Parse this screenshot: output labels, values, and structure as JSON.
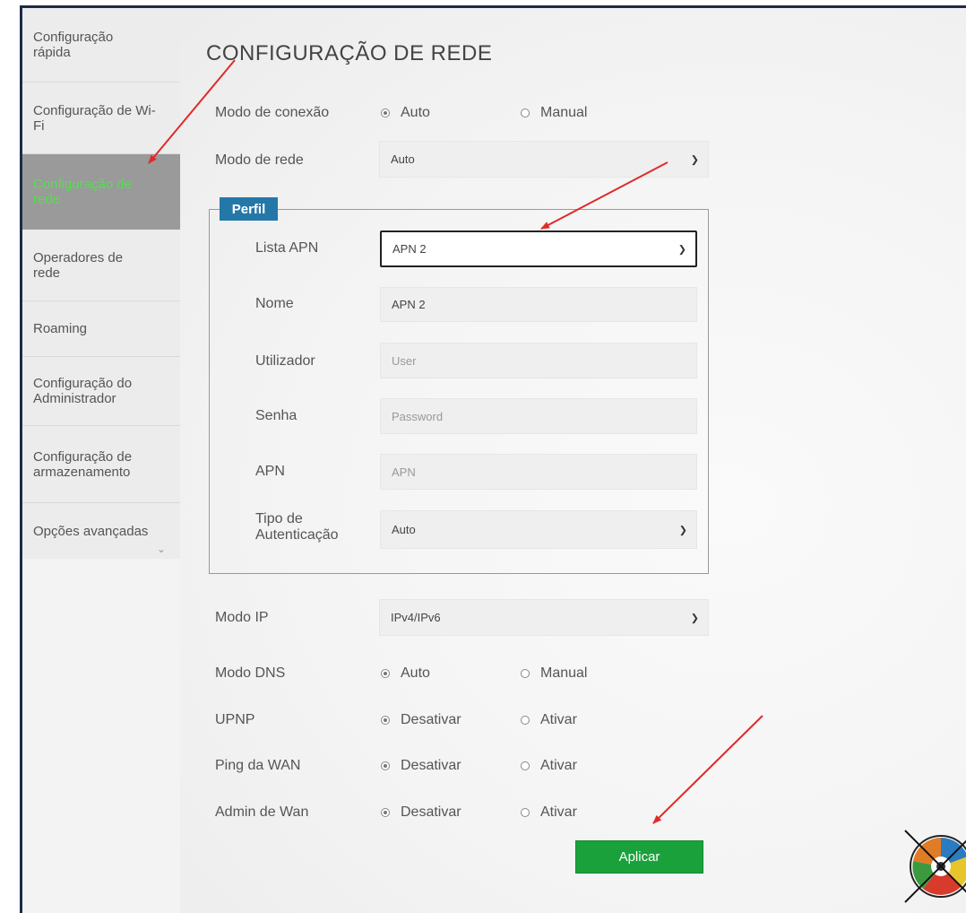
{
  "sidebar": {
    "items": [
      {
        "label": "Configuração rápida"
      },
      {
        "label": "Configuração de Wi-Fi"
      },
      {
        "label": "Configuração de rede"
      },
      {
        "label": "Operadores de rede"
      },
      {
        "label": "Roaming"
      },
      {
        "label": "Configuração do Administrador"
      },
      {
        "label": "Configuração de armazenamento"
      },
      {
        "label": "Opções avançadas"
      }
    ],
    "active_color": "#52e04f"
  },
  "page": {
    "title": "CONFIGURAÇÃO DE REDE"
  },
  "form": {
    "connection_mode": {
      "label": "Modo de conexão",
      "options": [
        "Auto",
        "Manual"
      ],
      "selected": "Auto"
    },
    "network_mode": {
      "label": "Modo de rede",
      "value": "Auto"
    },
    "profile": {
      "legend": "Perfil",
      "apn_list": {
        "label": "Lista APN",
        "value": "APN 2"
      },
      "name": {
        "label": "Nome",
        "value": "APN 2"
      },
      "user": {
        "label": "Utilizador",
        "placeholder": "User"
      },
      "password": {
        "label": "Senha",
        "placeholder": "Password"
      },
      "apn": {
        "label": "APN",
        "placeholder": "APN"
      },
      "auth_type": {
        "label_line1": "Tipo de",
        "label_line2": "Autenticação",
        "value": "Auto"
      }
    },
    "ip_mode": {
      "label": "Modo IP",
      "value": "IPv4/IPv6"
    },
    "dns_mode": {
      "label": "Modo DNS",
      "options": [
        "Auto",
        "Manual"
      ],
      "selected": "Auto"
    },
    "upnp": {
      "label": "UPNP",
      "options": [
        "Desativar",
        "Ativar"
      ],
      "selected": "Desativar"
    },
    "wan_ping": {
      "label": "Ping da WAN",
      "options": [
        "Desativar",
        "Ativar"
      ],
      "selected": "Desativar"
    },
    "wan_admin": {
      "label": "Admin de Wan",
      "options": [
        "Desativar",
        "Ativar"
      ],
      "selected": "Desativar"
    }
  },
  "actions": {
    "apply_label": "Aplicar",
    "apply_color": "#1aa13b"
  },
  "annotations": {
    "arrow_color": "#e02a2a"
  },
  "icons": [
    "chevron-down-icon",
    "annotation-arrow-icon",
    "logo-icon"
  ]
}
